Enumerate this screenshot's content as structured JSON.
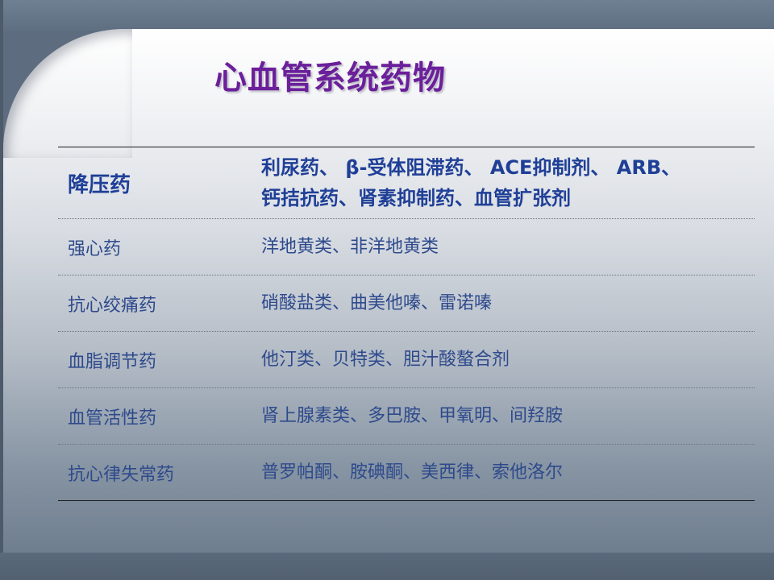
{
  "slide": {
    "title": "心血管系统药物",
    "accent_color": "#6b1f9a",
    "text_color": "#2e4a8c"
  },
  "table": {
    "rows": [
      {
        "name": "降压药",
        "drugs_line1": "利尿药、 β-受体阻滞药、 ACE抑制剂、 ARB、",
        "drugs_line2": "钙拮抗药、肾素抑制药、血管扩张剂"
      },
      {
        "name": "强心药",
        "drugs": "洋地黄类、非洋地黄类"
      },
      {
        "name": "抗心绞痛药",
        "drugs": "硝酸盐类、曲美他嗪、雷诺嗪"
      },
      {
        "name": "血脂调节药",
        "drugs": "他汀类、贝特类、胆汁酸螯合剂"
      },
      {
        "name": "血管活性药",
        "drugs": "肾上腺素类、多巴胺、甲氧明、间羟胺"
      },
      {
        "name": "抗心律失常药",
        "drugs": "普罗帕酮、胺碘酮、美西律、索他洛尔"
      }
    ]
  }
}
